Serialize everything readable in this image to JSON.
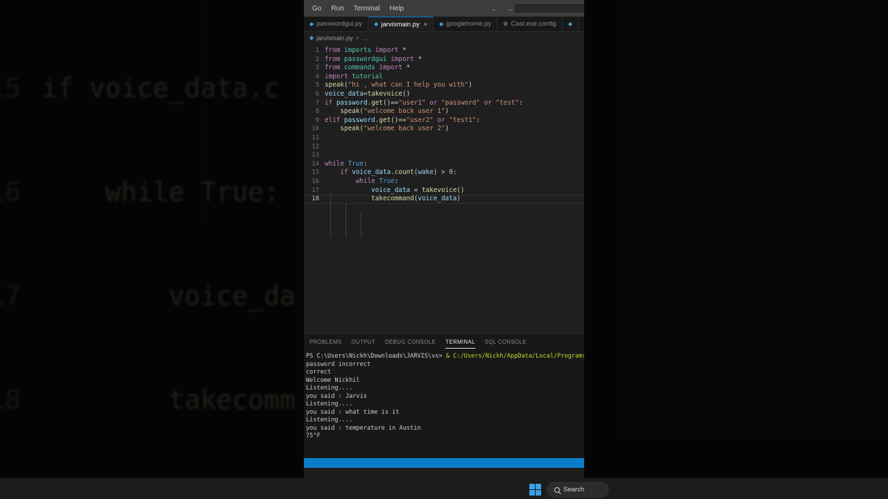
{
  "background": {
    "description": "blurred zoomed-in copy of the same python editor",
    "lines": [
      {
        "num": "15",
        "text": "if voice_data.c"
      },
      {
        "num": "16",
        "text": "    while True:"
      },
      {
        "num": "17",
        "text": "        voice_da"
      },
      {
        "num": "18",
        "text": "        takecomm"
      }
    ]
  },
  "window": {
    "menubar": {
      "items": [
        "Go",
        "Run",
        "Terminal",
        "Help"
      ],
      "back_icon": "arrow-left-icon",
      "forward_icon": "arrow-right-icon",
      "command_center_placeholder": ""
    },
    "tabs": [
      {
        "label": "passwordgui.py",
        "icon": "python-file-icon",
        "active": false,
        "closable": false
      },
      {
        "label": "jarvismain.py",
        "icon": "python-file-icon",
        "active": true,
        "closable": true,
        "close_label": "×"
      },
      {
        "label": "googlehome.py",
        "icon": "python-file-icon",
        "active": false,
        "closable": false
      },
      {
        "label": "Cast.exe.config",
        "icon": "gear-file-icon",
        "active": false,
        "closable": false
      }
    ],
    "breadcrumb": {
      "file_icon": "python-file-icon",
      "file": "jarvismain.py",
      "separator": ">",
      "trailing": "…"
    }
  },
  "editor": {
    "active_line": 18,
    "lines": [
      {
        "num": "1",
        "tokens": [
          {
            "t": "from",
            "c": "k"
          },
          {
            "t": " ",
            "c": "pl"
          },
          {
            "t": "imports",
            "c": "mo"
          },
          {
            "t": " ",
            "c": "pl"
          },
          {
            "t": "import",
            "c": "k"
          },
          {
            "t": " ",
            "c": "pl"
          },
          {
            "t": "*",
            "c": "op"
          }
        ]
      },
      {
        "num": "2",
        "tokens": [
          {
            "t": "from",
            "c": "k"
          },
          {
            "t": " ",
            "c": "pl"
          },
          {
            "t": "passwordgui",
            "c": "mo"
          },
          {
            "t": " ",
            "c": "pl"
          },
          {
            "t": "import",
            "c": "k"
          },
          {
            "t": " ",
            "c": "pl"
          },
          {
            "t": "*",
            "c": "op"
          }
        ]
      },
      {
        "num": "3",
        "tokens": [
          {
            "t": "from",
            "c": "k"
          },
          {
            "t": " ",
            "c": "pl"
          },
          {
            "t": "commands",
            "c": "mo"
          },
          {
            "t": " ",
            "c": "pl"
          },
          {
            "t": "import",
            "c": "k"
          },
          {
            "t": " ",
            "c": "pl"
          },
          {
            "t": "*",
            "c": "op"
          }
        ]
      },
      {
        "num": "4",
        "tokens": [
          {
            "t": "import",
            "c": "k"
          },
          {
            "t": " ",
            "c": "pl"
          },
          {
            "t": "tutorial",
            "c": "mo"
          }
        ]
      },
      {
        "num": "5",
        "tokens": [
          {
            "t": "speak",
            "c": "fn"
          },
          {
            "t": "(",
            "c": "op"
          },
          {
            "t": "\"hi , what can I help you with\"",
            "c": "st"
          },
          {
            "t": ")",
            "c": "op"
          }
        ]
      },
      {
        "num": "6",
        "tokens": [
          {
            "t": "voice_data",
            "c": "va"
          },
          {
            "t": "=",
            "c": "op"
          },
          {
            "t": "takevoice",
            "c": "fn"
          },
          {
            "t": "()",
            "c": "op"
          }
        ]
      },
      {
        "num": "7",
        "tokens": [
          {
            "t": "if",
            "c": "k"
          },
          {
            "t": " ",
            "c": "pl"
          },
          {
            "t": "password",
            "c": "va"
          },
          {
            "t": ".",
            "c": "op"
          },
          {
            "t": "get",
            "c": "fn"
          },
          {
            "t": "()",
            "c": "op"
          },
          {
            "t": "==",
            "c": "op"
          },
          {
            "t": "\"user1\"",
            "c": "st"
          },
          {
            "t": " ",
            "c": "pl"
          },
          {
            "t": "or",
            "c": "k"
          },
          {
            "t": " ",
            "c": "pl"
          },
          {
            "t": "\"password\"",
            "c": "st"
          },
          {
            "t": " ",
            "c": "pl"
          },
          {
            "t": "or",
            "c": "k"
          },
          {
            "t": " ",
            "c": "pl"
          },
          {
            "t": "\"test\"",
            "c": "st"
          },
          {
            "t": ":",
            "c": "op"
          }
        ]
      },
      {
        "num": "8",
        "tokens": [
          {
            "t": "    ",
            "c": "pl"
          },
          {
            "t": "speak",
            "c": "fn"
          },
          {
            "t": "(",
            "c": "op"
          },
          {
            "t": "\"welcome back user 1\"",
            "c": "st"
          },
          {
            "t": ")",
            "c": "op"
          }
        ]
      },
      {
        "num": "9",
        "tokens": [
          {
            "t": "elif",
            "c": "k"
          },
          {
            "t": " ",
            "c": "pl"
          },
          {
            "t": "password",
            "c": "va"
          },
          {
            "t": ".",
            "c": "op"
          },
          {
            "t": "get",
            "c": "fn"
          },
          {
            "t": "()",
            "c": "op"
          },
          {
            "t": "==",
            "c": "op"
          },
          {
            "t": "\"user2\"",
            "c": "st"
          },
          {
            "t": " ",
            "c": "pl"
          },
          {
            "t": "or",
            "c": "k"
          },
          {
            "t": " ",
            "c": "pl"
          },
          {
            "t": "\"test1\"",
            "c": "st"
          },
          {
            "t": ":",
            "c": "op"
          }
        ]
      },
      {
        "num": "10",
        "tokens": [
          {
            "t": "    ",
            "c": "pl"
          },
          {
            "t": "speak",
            "c": "fn"
          },
          {
            "t": "(",
            "c": "op"
          },
          {
            "t": "\"welcome back user 2\"",
            "c": "st"
          },
          {
            "t": ")",
            "c": "op"
          }
        ]
      },
      {
        "num": "11",
        "tokens": []
      },
      {
        "num": "12",
        "tokens": []
      },
      {
        "num": "13",
        "tokens": []
      },
      {
        "num": "14",
        "tokens": [
          {
            "t": "while",
            "c": "k"
          },
          {
            "t": " ",
            "c": "pl"
          },
          {
            "t": "True",
            "c": "kb"
          },
          {
            "t": ":",
            "c": "op"
          }
        ]
      },
      {
        "num": "15",
        "tokens": [
          {
            "t": "    ",
            "c": "pl"
          },
          {
            "t": "if",
            "c": "k"
          },
          {
            "t": " ",
            "c": "pl"
          },
          {
            "t": "voice_data",
            "c": "va"
          },
          {
            "t": ".",
            "c": "op"
          },
          {
            "t": "count",
            "c": "fn"
          },
          {
            "t": "(",
            "c": "op"
          },
          {
            "t": "wake",
            "c": "va"
          },
          {
            "t": ")",
            "c": "op"
          },
          {
            "t": " > ",
            "c": "op"
          },
          {
            "t": "0",
            "c": "nu"
          },
          {
            "t": ":",
            "c": "op"
          }
        ]
      },
      {
        "num": "16",
        "tokens": [
          {
            "t": "        ",
            "c": "pl"
          },
          {
            "t": "while",
            "c": "k"
          },
          {
            "t": " ",
            "c": "pl"
          },
          {
            "t": "True",
            "c": "kb"
          },
          {
            "t": ":",
            "c": "op"
          }
        ]
      },
      {
        "num": "17",
        "tokens": [
          {
            "t": "            ",
            "c": "pl"
          },
          {
            "t": "voice_data",
            "c": "va"
          },
          {
            "t": " = ",
            "c": "op"
          },
          {
            "t": "takevoice",
            "c": "fn"
          },
          {
            "t": "()",
            "c": "op"
          }
        ]
      },
      {
        "num": "18",
        "tokens": [
          {
            "t": "            ",
            "c": "pl"
          },
          {
            "t": "takecommand",
            "c": "fn"
          },
          {
            "t": "(",
            "c": "op"
          },
          {
            "t": "voice_data",
            "c": "va"
          },
          {
            "t": ")",
            "c": "op"
          }
        ]
      }
    ]
  },
  "panel": {
    "tabs": [
      {
        "label": "PROBLEMS",
        "active": false
      },
      {
        "label": "OUTPUT",
        "active": false
      },
      {
        "label": "DEBUG CONSOLE",
        "active": false
      },
      {
        "label": "TERMINAL",
        "active": true
      },
      {
        "label": "SQL CONSOLE",
        "active": false
      }
    ],
    "terminal_lines": [
      {
        "prompt": "PS C:\\Users\\Nickh\\Downloads\\JARVIS\\vs> ",
        "command": "& C:/Users/Nickh/AppData/Local/Programs/Python"
      },
      {
        "text": "password incorrect"
      },
      {
        "text": "correct"
      },
      {
        "text": "Welcome Nickhil"
      },
      {
        "text": "Listening...."
      },
      {
        "text": "you said : Jarvis"
      },
      {
        "text": "Listening...."
      },
      {
        "text": "you said : what time is it"
      },
      {
        "text": "Listening...."
      },
      {
        "text": "you said : temperature in Austin"
      },
      {
        "text": "75°F"
      }
    ]
  },
  "taskbar": {
    "start_icon": "windows-logo-icon",
    "search_icon": "search-icon",
    "search_label": "Search"
  },
  "colors": {
    "accent": "#0078d4",
    "bluebar": "#0b7cc8",
    "editor_bg": "#1f1f1f",
    "panel_bg": "#181818",
    "titlebar_bg": "#3c3c3c",
    "taskbar_bg": "#1c1c1c",
    "win_logo": "#3aa0e8"
  }
}
